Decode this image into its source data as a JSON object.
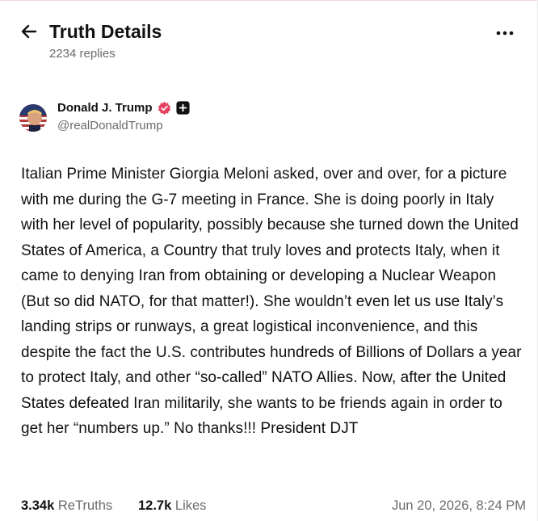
{
  "header": {
    "title": "Truth Details",
    "replies": "2234 replies",
    "back_icon": "arrow-left-icon",
    "more_icon": "ellipsis-icon"
  },
  "author": {
    "display_name": "Donald J. Trump",
    "handle": "@realDonaldTrump",
    "verified_icon": "verified-badge-icon",
    "follow_icon": "plus-icon"
  },
  "post": {
    "text": "Italian Prime Minister Giorgia Meloni asked, over and over, for a picture with me during the G-7 meeting in France. She is doing poorly in Italy with her level of popularity, possibly because she turned down the United States of America, a Country that truly loves and protects Italy, when it came to denying Iran from obtaining or developing a Nuclear Weapon (But so did NATO, for that matter!). She wouldn’t even let us use Italy’s landing strips or runways, a great logistical inconvenience, and this despite the fact the U.S. contributes hundreds of Billions of Dollars a year to protect Italy, and other “so-called” NATO Allies. Now, after the United States defeated Iran militarily, she wants to be friends again in order to get her “numbers up.” No thanks!!! President DJT"
  },
  "stats": {
    "retruths_count": "3.34k",
    "retruths_label": "ReTruths",
    "likes_count": "12.7k",
    "likes_label": "Likes",
    "timestamp": "Jun 20, 2026, 8:24 PM"
  },
  "colors": {
    "text": "#111111",
    "muted": "#6b6b70",
    "verified_badge": "#e4405f"
  }
}
